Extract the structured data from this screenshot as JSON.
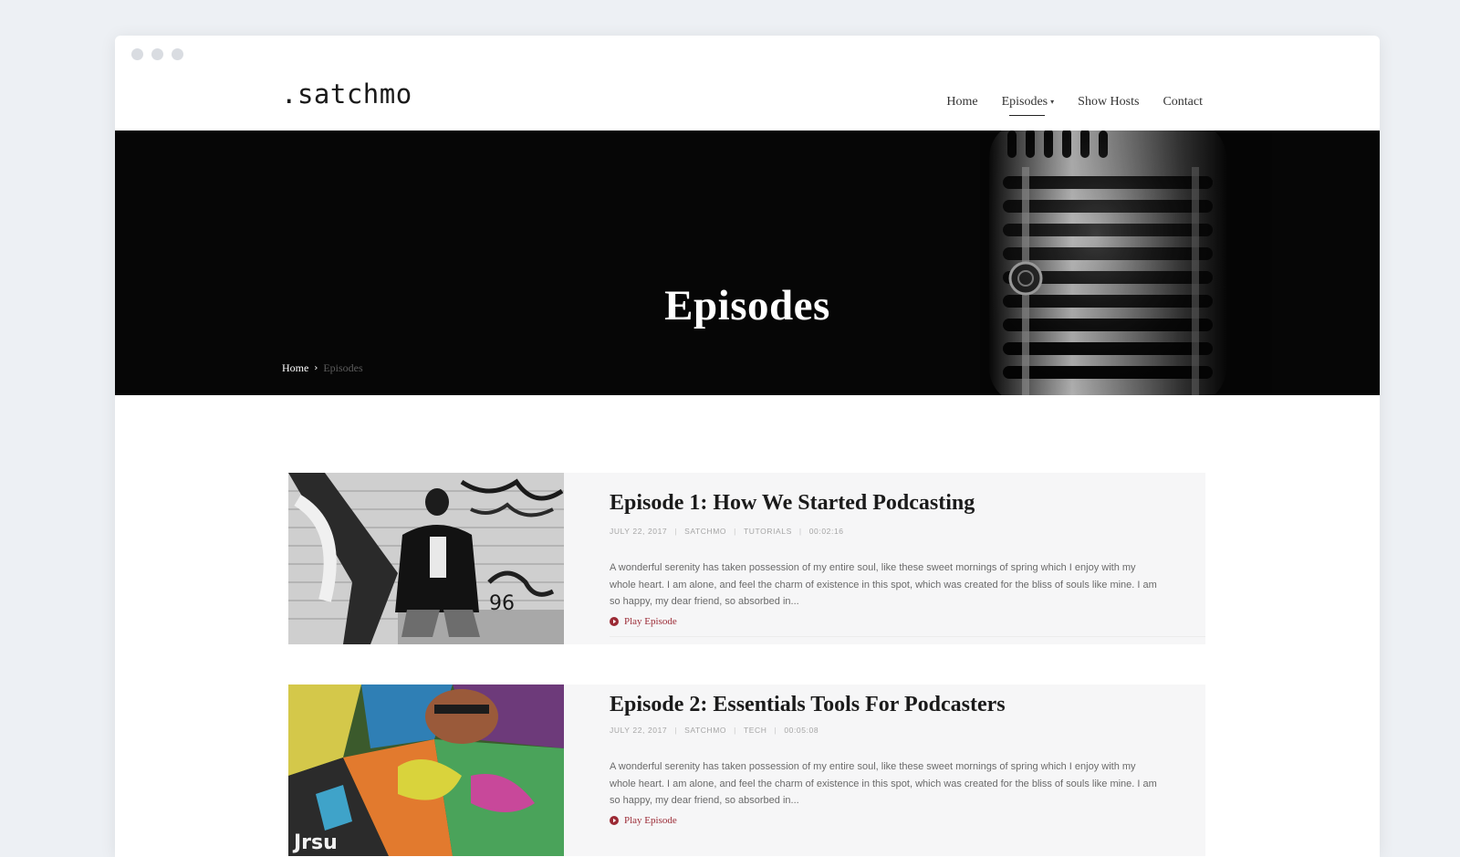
{
  "site": {
    "logo": ".satchmo",
    "nav": [
      {
        "label": "Home"
      },
      {
        "label": "Episodes",
        "active": true
      },
      {
        "label": "Show Hosts"
      },
      {
        "label": "Contact"
      }
    ]
  },
  "hero": {
    "title": "Episodes",
    "breadcrumb": {
      "home": "Home",
      "separator": "›",
      "current": "Episodes"
    }
  },
  "episodes": [
    {
      "title": "Episode 1: How We Started Podcasting",
      "meta": [
        "JULY 22, 2017",
        "SATCHMO",
        "TUTORIALS",
        "00:02:16"
      ],
      "excerpt": "A wonderful serenity has taken possession of my entire soul, like these sweet mornings of spring which I enjoy with my whole heart. I am alone, and feel the charm of existence in this spot, which was created for the bliss of souls like mine. I am so happy, my dear friend, so absorbed in...",
      "play_label": "Play Episode"
    },
    {
      "title": "Episode 2: Essentials Tools For Podcasters",
      "meta": [
        "JULY 22, 2017",
        "SATCHMO",
        "TECH",
        "00:05:08"
      ],
      "excerpt": "A wonderful serenity has taken possession of my entire soul, like these sweet mornings of spring which I enjoy with my whole heart. I am alone, and feel the charm of existence in this spot, which was created for the bliss of souls like mine. I am so happy, my dear friend, so absorbed in...",
      "play_label": "Play Episode"
    }
  ],
  "colors": {
    "accent": "#9b2a35",
    "hero_bg": "#060606",
    "page_bg": "#edf0f4"
  }
}
